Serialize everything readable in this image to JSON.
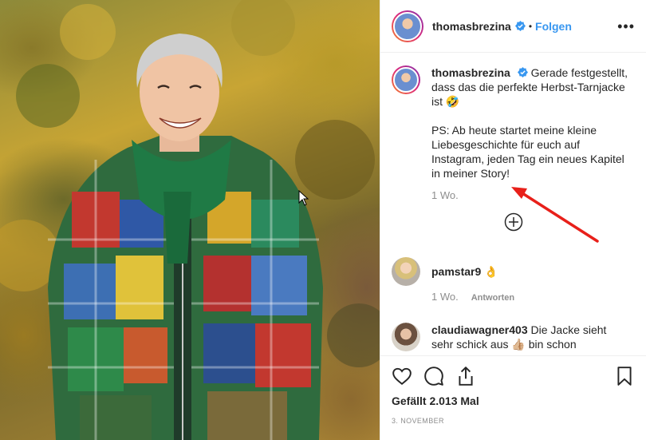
{
  "post": {
    "author": "thomasbrezina",
    "follow_label": "Folgen",
    "separator": "•",
    "more_label": "•••"
  },
  "caption": {
    "username": "thomasbrezina",
    "line1": "Gerade festgestellt, dass das die perfekte Herbst-Tarnjacke ist 🤣",
    "line2": "PS: Ab heute startet meine kleine Liebesgeschichte für euch auf Instagram, jeden Tag ein neues Kapitel in meiner Story!",
    "age": "1 Wo."
  },
  "comments": [
    {
      "username": "pamstar9",
      "text": "👌",
      "age": "1 Wo.",
      "reply_label": "Antworten"
    },
    {
      "username": "claudiawagner403",
      "text": "Die Jacke sieht sehr schick aus 👍🏼 bin schon"
    }
  ],
  "footer": {
    "likes": "Gefällt 2.013 Mal",
    "date": "3. NOVEMBER"
  },
  "icons": {
    "like": "heart-icon",
    "comment": "comment-icon",
    "share": "share-icon",
    "save": "bookmark-icon",
    "add_comment": "plus-circle-icon",
    "verified": "verified-badge-icon"
  },
  "colors": {
    "accent": "#3897f0",
    "annotation_arrow": "#e8201a",
    "muted_text": "#8e8e8e"
  }
}
